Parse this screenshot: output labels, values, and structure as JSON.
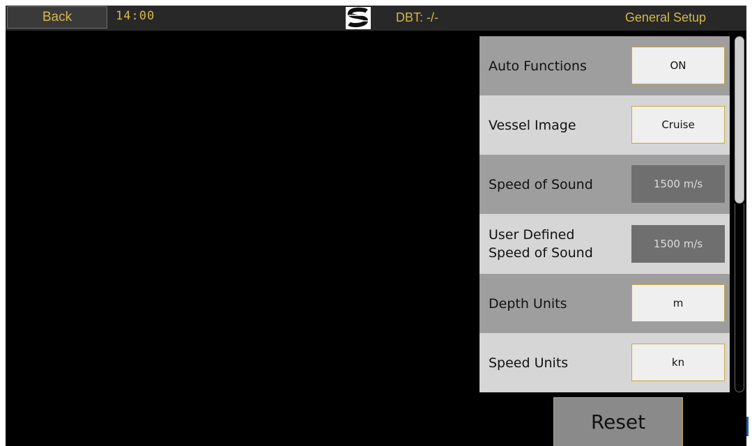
{
  "topbar": {
    "back_label": "Back",
    "clock": "14:00",
    "logo_icon": "s-logo-icon",
    "dbt": "DBT: -/-",
    "title": "General Setup"
  },
  "settings": [
    {
      "label": "Auto Functions",
      "value": "ON",
      "enabled": true
    },
    {
      "label": "Vessel Image",
      "value": "Cruise",
      "enabled": true
    },
    {
      "label": "Speed of Sound",
      "value": "1500 m/s",
      "enabled": false
    },
    {
      "label_line1": "User Defined",
      "label_line2": "Speed of Sound",
      "value": "1500 m/s",
      "enabled": false
    },
    {
      "label": "Depth Units",
      "value": "m",
      "enabled": true
    },
    {
      "label": "Speed Units",
      "value": "kn",
      "enabled": true
    }
  ],
  "footer": {
    "reset_label": "Reset"
  },
  "colors": {
    "accent": "#d4b84a",
    "panel_dark": "#9e9e9e",
    "panel_light": "#d6d6d6",
    "disabled_value": "#6f6f6f"
  }
}
